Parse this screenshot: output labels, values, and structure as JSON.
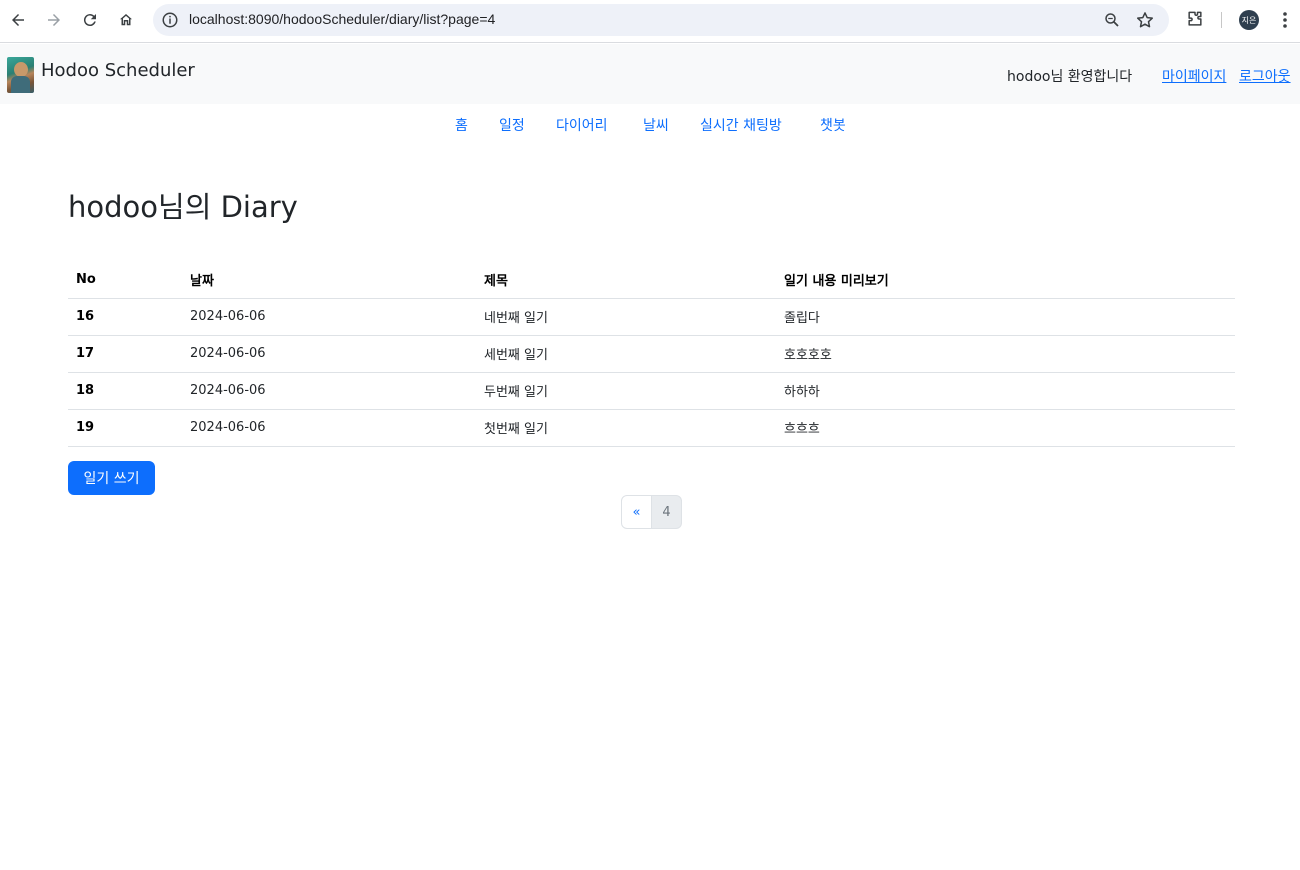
{
  "browser": {
    "url": "localhost:8090/hodooScheduler/diary/list?page=4",
    "profile_initials": "지은"
  },
  "header": {
    "brand": "Hodoo Scheduler",
    "welcome": "hodoo님 환영합니다",
    "mypage_label": "마이페이지",
    "logout_label": "로그아웃"
  },
  "nav": {
    "items": [
      "홈",
      "일정",
      "다이어리",
      "날씨",
      "실시간 채팅방",
      "챗봇"
    ]
  },
  "main": {
    "title": "hodoo님의 Diary",
    "table": {
      "headers": [
        "No",
        "날짜",
        "제목",
        "일기 내용 미리보기"
      ],
      "rows": [
        [
          "16",
          "2024-06-06",
          "네번째 일기",
          "졸립다"
        ],
        [
          "17",
          "2024-06-06",
          "세번째 일기",
          "호호호호"
        ],
        [
          "18",
          "2024-06-06",
          "두번째 일기",
          "하하하"
        ],
        [
          "19",
          "2024-06-06",
          "첫번째 일기",
          "흐흐흐"
        ]
      ]
    },
    "write_button": "일기 쓰기",
    "pagination": {
      "prev": "«",
      "current": "4"
    }
  },
  "colors": {
    "link": "#0d6efd",
    "primary_button": "#0d6efd",
    "header_bg": "#f8f9fa"
  }
}
